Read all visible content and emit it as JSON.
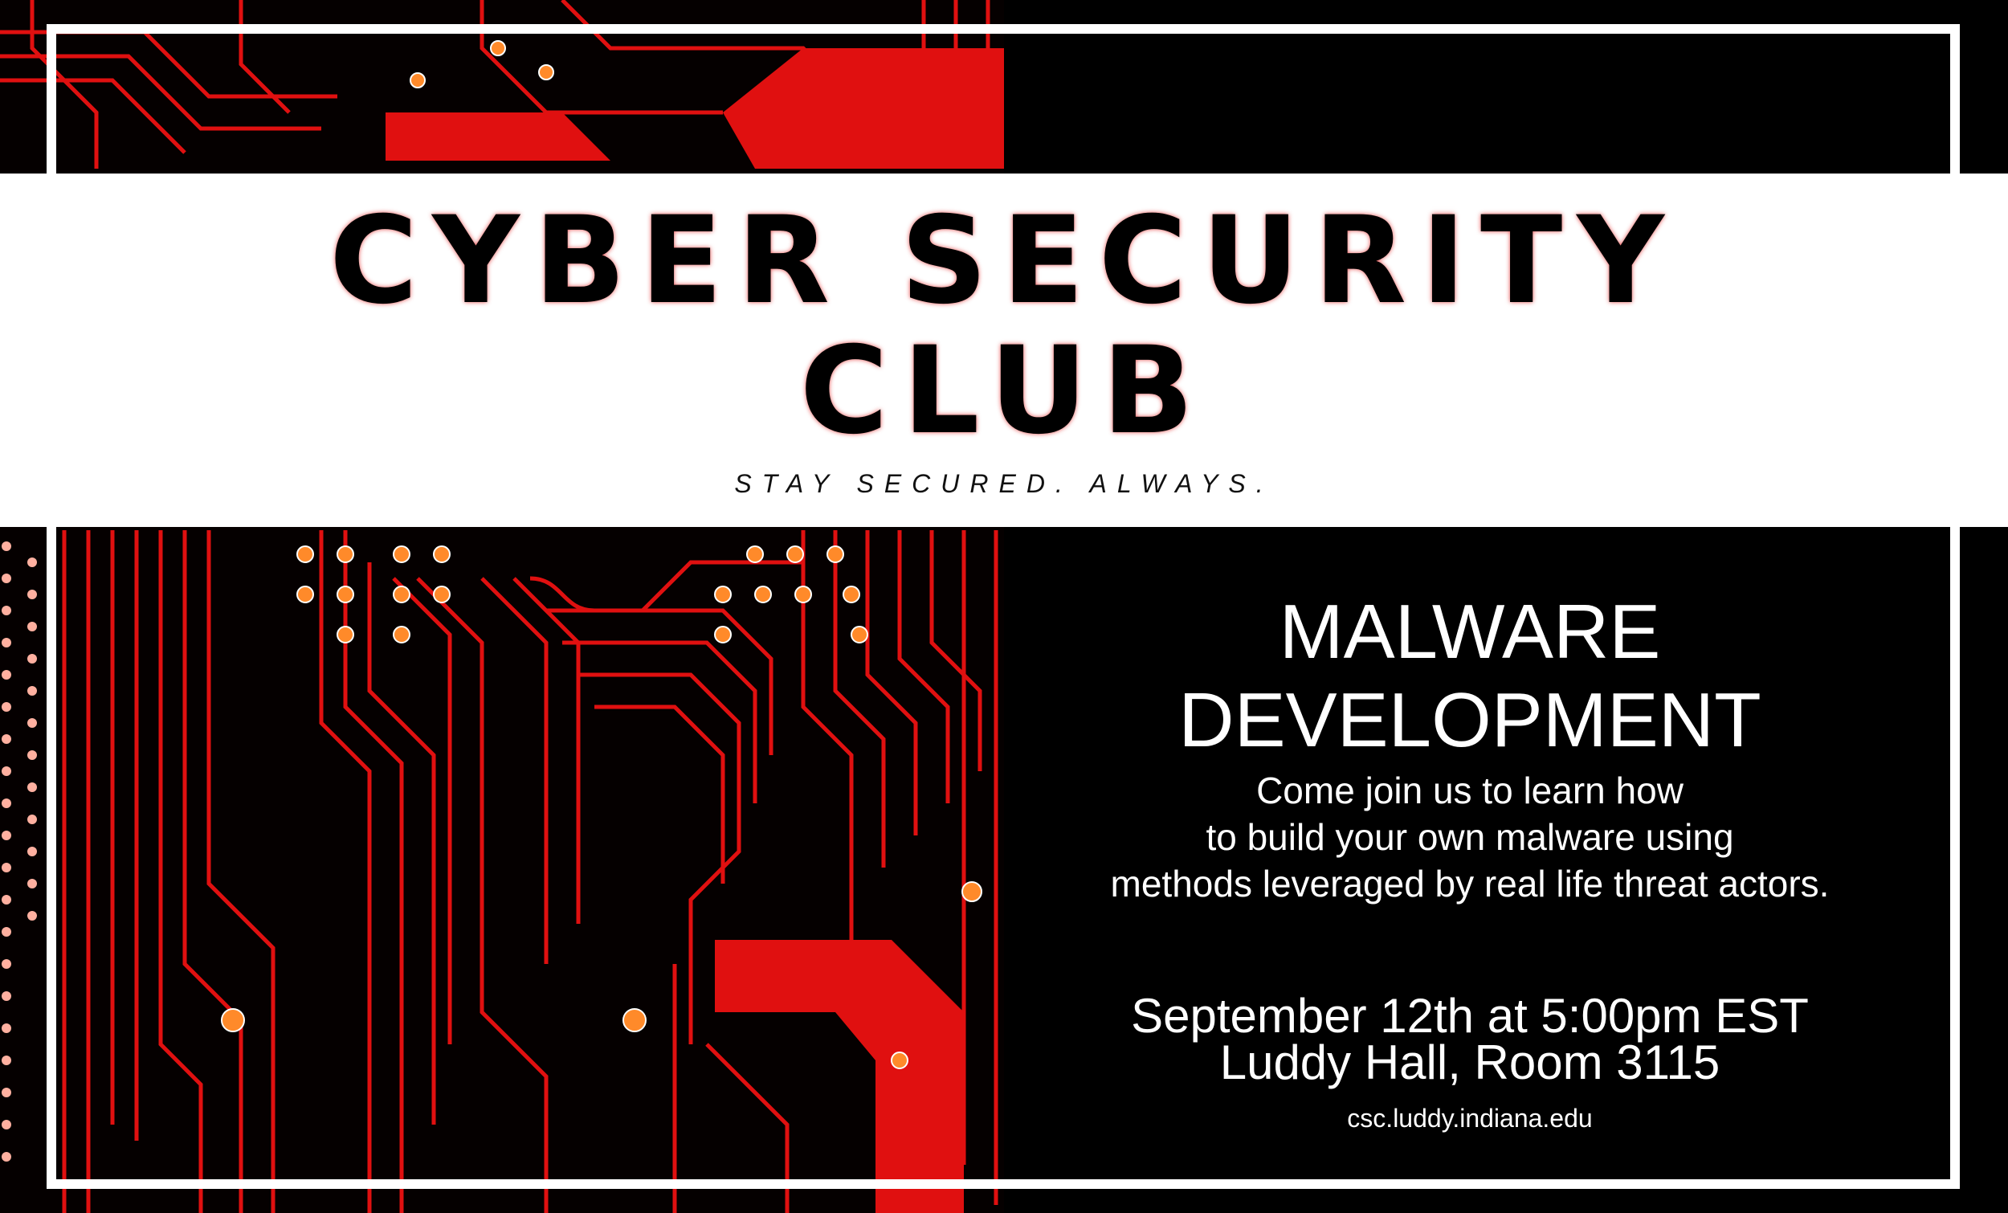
{
  "poster": {
    "title_line1": "Cyber Security",
    "title_line2": "Club",
    "tagline": "STAY SECURED. ALWAYS.",
    "event_title": "MALWARE DEVELOPMENT",
    "description": [
      "Come join us to learn how",
      "to build your own malware using",
      "methods leveraged by real life threat actors."
    ],
    "date_time": "September 12th at 5:00pm EST",
    "location": "Luddy Hall, Room 3115",
    "website": "csc.luddy.indiana.edu"
  },
  "colors": {
    "background": "#000000",
    "circuit_red": "#e01010",
    "frame": "#ffffff",
    "title_glow": "#dc1414"
  },
  "icons": [
    "circuit-board-image"
  ]
}
